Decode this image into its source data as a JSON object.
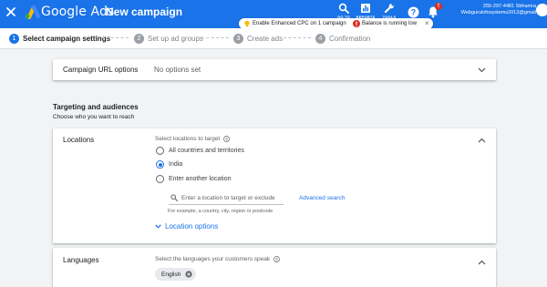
{
  "header": {
    "brand": "Google Ads",
    "title": "New campaign",
    "tools": [
      {
        "label": "GO TO",
        "icon": "search-icon"
      },
      {
        "label": "REPORTS",
        "icon": "reports-icon"
      },
      {
        "label": "TOOLS",
        "icon": "wrench-icon"
      }
    ],
    "notification_badge": "!",
    "account_line1": "255-297-4481 Sbhamra",
    "account_line2": "Webguruinfosystems2012@gmail",
    "colors": {
      "bar": "#1a73e8",
      "badge": "#d93025"
    }
  },
  "chips": {
    "tip_text": "Enable Enhanced CPC on 1 campaign",
    "warning_text": "Balance is running low",
    "close": "×",
    "colors": {
      "tip": "#fbbc04",
      "warning": "#d93025"
    }
  },
  "steps": [
    {
      "num": "1",
      "label": "Select campaign settings",
      "active": true
    },
    {
      "num": "2",
      "label": "Set up ad groups",
      "active": false
    },
    {
      "num": "3",
      "label": "Create ads",
      "active": false
    },
    {
      "num": "4",
      "label": "Confirmation",
      "active": false
    }
  ],
  "url_options": {
    "title": "Campaign URL options",
    "value": "No options set"
  },
  "targeting": {
    "title": "Targeting and audiences",
    "subtitle": "Choose who you want to reach"
  },
  "locations": {
    "title": "Locations",
    "heading": "Select locations to target",
    "options": [
      {
        "label": "All countries and territories",
        "checked": false
      },
      {
        "label": "India",
        "checked": true
      },
      {
        "label": "Enter another location",
        "checked": false
      }
    ],
    "search_placeholder": "Enter a location to target or exclude",
    "advanced_search": "Advanced search",
    "hint": "For example, a country, city, region or postcode",
    "location_options": "Location options"
  },
  "languages": {
    "title": "Languages",
    "heading": "Select the languages your customers speak",
    "selected": [
      "English"
    ]
  }
}
